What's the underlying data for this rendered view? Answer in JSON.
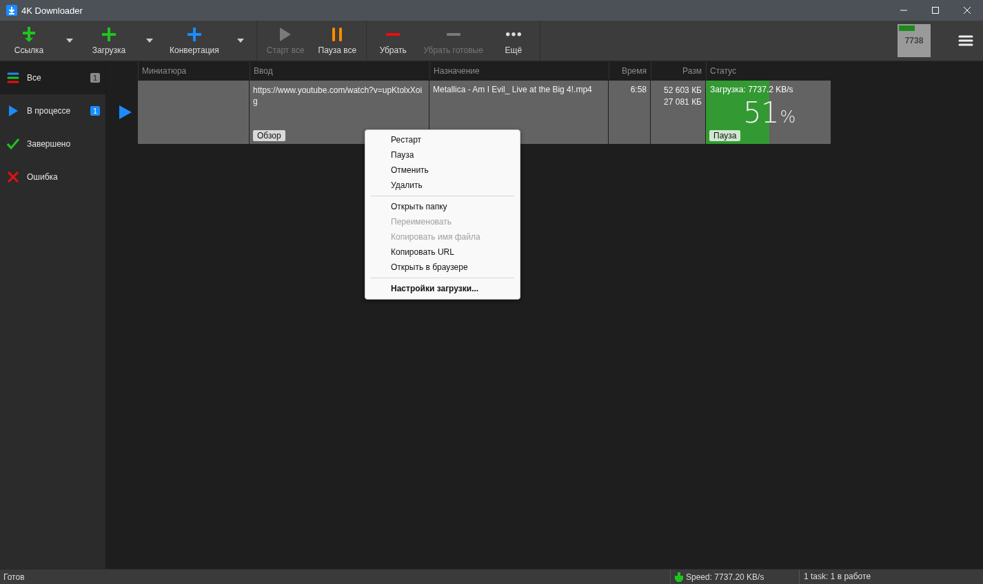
{
  "window": {
    "title": "4K Downloader"
  },
  "toolbar": {
    "groups": [
      [
        {
          "kind": "link",
          "label": "Ссылка",
          "disabled": false,
          "dropdown": true
        },
        {
          "kind": "download",
          "label": "Загрузка",
          "disabled": false,
          "dropdown": true
        },
        {
          "kind": "convert",
          "label": "Конвертация",
          "disabled": false,
          "dropdown": true
        }
      ],
      [
        {
          "kind": "start",
          "label": "Старт все",
          "disabled": true,
          "dropdown": false
        },
        {
          "kind": "pause",
          "label": "Пауза все",
          "disabled": false,
          "dropdown": false
        }
      ],
      [
        {
          "kind": "remove",
          "label": "Убрать",
          "disabled": false,
          "dropdown": false
        },
        {
          "kind": "remove-done",
          "label": "Убрать готовые",
          "disabled": true,
          "dropdown": false
        },
        {
          "kind": "more",
          "label": "Ещё",
          "disabled": false,
          "dropdown": false
        }
      ]
    ],
    "speed_widget": "7738"
  },
  "sidebar": {
    "items": [
      {
        "kind": "all",
        "label": "Все",
        "count": "1",
        "selected": true
      },
      {
        "kind": "progress",
        "label": "В процессе",
        "count": "1",
        "selected": false
      },
      {
        "kind": "done",
        "label": "Завершено",
        "selected": false
      },
      {
        "kind": "error",
        "label": "Ошибка",
        "selected": false
      }
    ]
  },
  "table": {
    "columns": [
      "Миниатюра",
      "Ввод",
      "Назначение",
      "Время",
      "Разм",
      "Статус"
    ],
    "rows": [
      {
        "selected": true,
        "active": true,
        "input": "https://www.youtube.com/watch?v=upKtolxXoig",
        "browse_button": "Обзор",
        "destination": "Metallica - Am I Evil_ Live at the Big 4!.mp4",
        "time": "6:58",
        "sizes": [
          "52 603 КБ",
          "27 081 КБ"
        ],
        "status": "Загрузка: 7737.2 KB/s",
        "percent": "51",
        "percent_sign": "%",
        "level": 0.51,
        "pause_button": "Пауза"
      }
    ]
  },
  "context_menu": {
    "sections": [
      [
        {
          "label": "Рестарт",
          "disabled": false,
          "default": false
        },
        {
          "label": "Пауза",
          "disabled": false,
          "default": false
        },
        {
          "label": "Отменить",
          "disabled": false,
          "default": false
        },
        {
          "label": "Удалить",
          "disabled": false,
          "default": false
        }
      ],
      [
        {
          "label": "Открыть папку",
          "disabled": false,
          "default": false
        },
        {
          "label": "Переименовать",
          "disabled": true,
          "default": false
        },
        {
          "label": "Копировать имя файла",
          "disabled": true,
          "default": false
        },
        {
          "label": "Копировать URL",
          "disabled": false,
          "default": false
        },
        {
          "label": "Открыть в браузере",
          "disabled": false,
          "default": false
        }
      ],
      [
        {
          "label": "Настройки загрузки...",
          "disabled": false,
          "default": true
        }
      ]
    ]
  },
  "status_bar": {
    "status": "Готов",
    "speed": "Speed: 7737.20 KB/s",
    "tasks": "1 task: 1 в работе"
  }
}
